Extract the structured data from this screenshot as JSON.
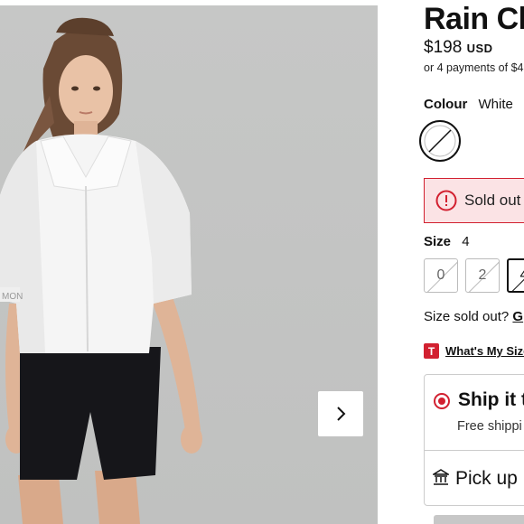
{
  "product": {
    "title": "Rain Ch",
    "price_amount": "$198",
    "price_currency": "USD",
    "installments": "or 4 payments of $4"
  },
  "colour": {
    "label": "Colour",
    "value": "White"
  },
  "alert": {
    "text": "Sold out"
  },
  "size": {
    "label": "Size",
    "value": "4",
    "options": [
      "0",
      "2",
      "4"
    ],
    "selected": "4"
  },
  "size_sold_out": {
    "text": "Size sold out?",
    "link": "G"
  },
  "size_guide": {
    "badge": "T",
    "link": "What's My Size"
  },
  "fulfillment": {
    "ship_title": "Ship it t",
    "ship_subtitle": "Free shippi",
    "pickup_title": "Pick up"
  },
  "gallery": {
    "next_icon": "chevron-right-icon"
  },
  "colors": {
    "accent_red": "#d22030",
    "alert_bg": "#fbe3e5",
    "photo_bg": "#c4c5c4"
  }
}
